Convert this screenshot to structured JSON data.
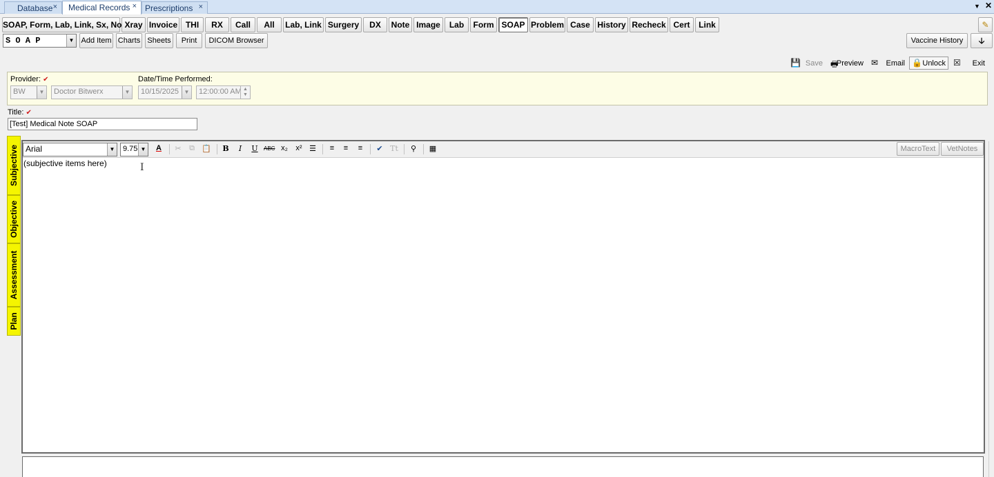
{
  "doc_tabs": [
    {
      "label": "Database"
    },
    {
      "label": "Medical Records"
    },
    {
      "label": "Prescriptions"
    }
  ],
  "tab_close": "×",
  "toolbar_row1": [
    "SOAP, Form, Lab, Link, Sx, Note",
    "Xray",
    "Invoice",
    "THI",
    "RX",
    "Call",
    "All",
    "Lab, Link",
    "Surgery",
    "DX",
    "Note",
    "Image",
    "Lab",
    "Form",
    "SOAP",
    "Problem",
    "Case",
    "History",
    "Recheck",
    "Cert",
    "Link"
  ],
  "toolbar_row2": {
    "type_select": "S O A P",
    "add_item": "Add Item",
    "charts": "Charts",
    "sheets": "Sheets",
    "print": "Print",
    "dicom": "DICOM Browser",
    "vaccine_history": "Vaccine History"
  },
  "actions": {
    "save": "Save",
    "preview": "Preview",
    "email": "Email",
    "unlock": "Unlock",
    "exit": "Exit"
  },
  "form": {
    "provider_label": "Provider:",
    "provider_code": "BW",
    "provider_name": "Doctor Bitwerx",
    "datetime_label": "Date/Time Performed:",
    "date": "10/15/2025",
    "time": "12:00:00 AM",
    "title_label": "Title:",
    "title_value": "[Test] Medical Note SOAP"
  },
  "soap_tabs": [
    "Subjective",
    "Objective",
    "Assessment",
    "Plan"
  ],
  "editor": {
    "font": "Arial",
    "size": "9.75",
    "content": "(subjective items here)",
    "macrotext": "MacroText",
    "vetnotes": "VetNotes"
  },
  "colors": {
    "panel_bg": "#fdfde6",
    "soap_tab": "#f5f500",
    "tabstrip": "#d4e3f5"
  }
}
